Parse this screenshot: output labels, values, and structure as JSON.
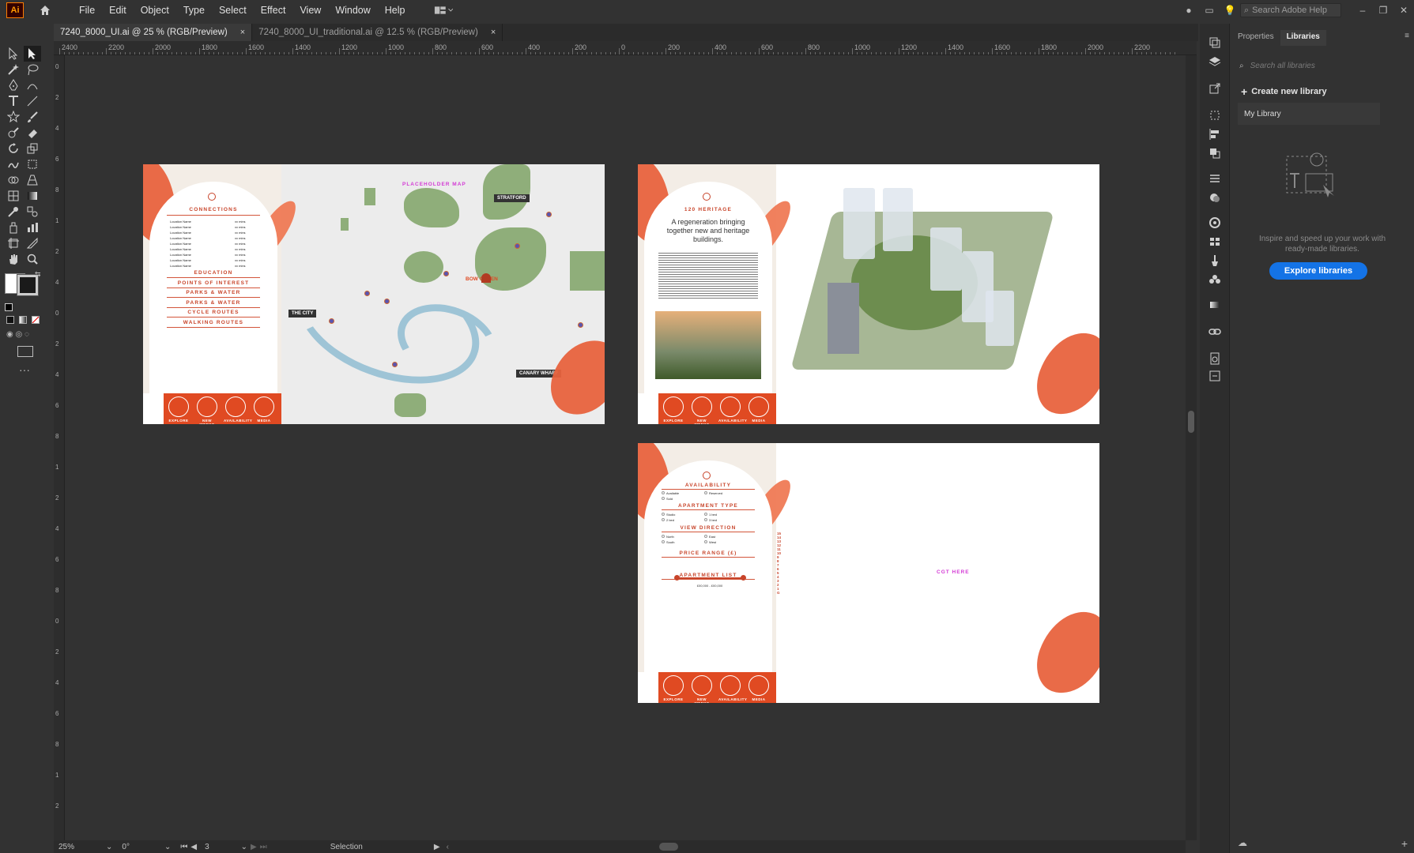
{
  "menubar": {
    "app_logo": "Ai",
    "items": [
      "File",
      "Edit",
      "Object",
      "Type",
      "Select",
      "Effect",
      "View",
      "Window",
      "Help"
    ],
    "search_placeholder": "Search Adobe Help"
  },
  "tabs": [
    {
      "label": "7240_8000_UI.ai @ 25 % (RGB/Preview)",
      "close": "×",
      "active": true
    },
    {
      "label": "7240_8000_UI_traditional.ai @ 12.5 % (RGB/Preview)",
      "close": "×",
      "active": false
    }
  ],
  "ruler_h_labels": [
    "2400",
    "2200",
    "2000",
    "1800",
    "1600",
    "1400",
    "1200",
    "1000",
    "800",
    "600",
    "400",
    "200",
    "0",
    "200",
    "400",
    "600",
    "800",
    "1000",
    "1200",
    "1400",
    "1600",
    "1800",
    "2000",
    "2200"
  ],
  "ruler_v_labels": [
    "0",
    "2",
    "4",
    "6",
    "8",
    "1",
    "2",
    "4",
    "0",
    "2",
    "4",
    "6",
    "8",
    "1",
    "2",
    "4",
    "6",
    "8",
    "0",
    "2",
    "4",
    "6",
    "8",
    "1",
    "2"
  ],
  "artboards": {
    "map": {
      "placeholder": "PLACEHOLDER MAP",
      "sidebar_title": "CONNECTIONS",
      "location_rows": [
        "Location Name",
        "Location Name",
        "Location Name",
        "Location Name",
        "Location Name",
        "Location Name",
        "Location Name",
        "Location Name",
        "Location Name"
      ],
      "time_value": "xx mins",
      "menu": [
        "EDUCATION",
        "POINTS OF INTEREST",
        "PARKS & WATER",
        "PARKS & WATER",
        "CYCLE ROUTES",
        "WALKING ROUTES"
      ],
      "labels": [
        "STRATFORD",
        "THE CITY",
        "CANARY WHARF"
      ],
      "pink_area": "BOW GREEN",
      "footer_icons": [
        "EXPLORE",
        "NEW WEEKS",
        "AVAILABILITY",
        "MEDIA"
      ]
    },
    "heritage": {
      "title": "120 HERITAGE",
      "headline": "A regeneration bringing together new and heritage buildings.",
      "footer_icons": [
        "EXPLORE",
        "NEW WEEKS",
        "AVAILABILITY",
        "MEDIA"
      ]
    },
    "availability": {
      "sections": [
        "AVAILABILITY",
        "APARTMENT TYPE",
        "VIEW DIRECTION",
        "PRICE RANGE (£)",
        "APARTMENT LIST"
      ],
      "availability_opts": [
        "Available",
        "Reserved",
        "Sold"
      ],
      "type_opts": [
        "Studio",
        "1 bed",
        "2 bed",
        "3 bed"
      ],
      "view_opts": [
        "North",
        "East",
        "South",
        "West"
      ],
      "price_label": "£00,000 - £00,000",
      "floors": [
        "15",
        "14",
        "13",
        "12",
        "11",
        "10",
        "9",
        "8",
        "7",
        "6",
        "5",
        "4",
        "3",
        "2",
        "1",
        "G"
      ],
      "placeholder": "CGT HERE",
      "footer_icons": [
        "EXPLORE",
        "NEW WEEKS",
        "AVAILABILITY",
        "MEDIA"
      ]
    }
  },
  "panel": {
    "tab_properties": "Properties",
    "tab_libraries": "Libraries",
    "search_placeholder": "Search all libraries",
    "create_library": "Create new library",
    "my_library": "My Library",
    "help_text": "Inspire and speed up your work with ready-made libraries.",
    "explore_button": "Explore libraries"
  },
  "status": {
    "zoom": "25%",
    "rotate": "0°",
    "artboard_num": "3",
    "tool": "Selection"
  },
  "colors": {
    "accent": "#e04a22",
    "brand_blue": "#1473e6",
    "pink": "#d33ad5"
  }
}
